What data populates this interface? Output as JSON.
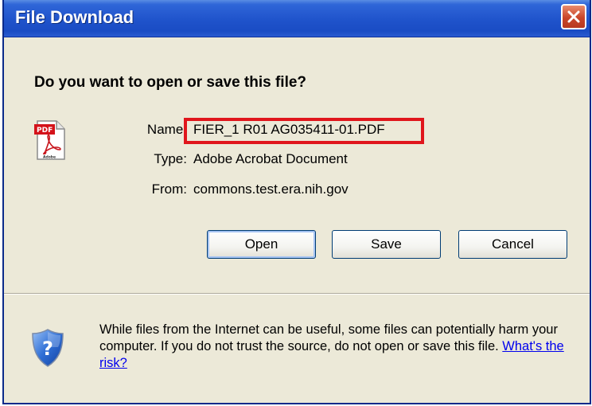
{
  "window": {
    "title": "File Download",
    "close_label": "Close"
  },
  "dialog": {
    "question": "Do you want to open or save this file?",
    "file_icon": "pdf-file-icon",
    "name_label": "Name:",
    "name_value": "FIER_1 R01 AG035411-01.PDF",
    "type_label": "Type:",
    "type_value": "Adobe Acrobat Document",
    "from_label": "From:",
    "from_value": "commons.test.era.nih.gov",
    "highlight_color": "#e0161c"
  },
  "buttons": {
    "open": "Open",
    "save": "Save",
    "cancel": "Cancel"
  },
  "warning": {
    "icon": "shield-question-icon",
    "text": "While files from the Internet can be useful, some files can potentially harm your computer. If you do not trust the source, do not open or save this file.",
    "link": "What's the risk?"
  }
}
